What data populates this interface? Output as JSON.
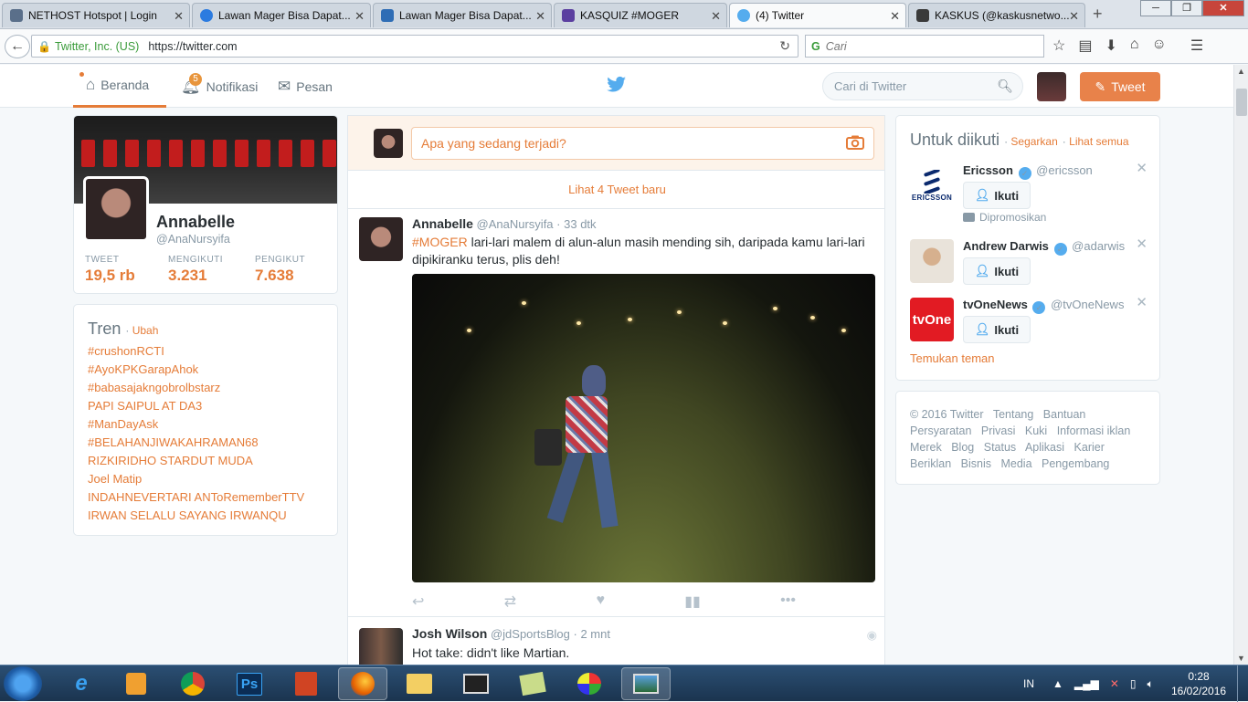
{
  "browser": {
    "tabs": [
      {
        "title": "NETHOST Hotspot | Login",
        "fav": "#5a6f8a"
      },
      {
        "title": "Lawan Mager Bisa Dapat...",
        "fav": "#2b7be0"
      },
      {
        "title": "Lawan Mager Bisa Dapat...",
        "fav": "#2f6db5"
      },
      {
        "title": "KASQUIZ #MOGER",
        "fav": "#5b3fa0"
      },
      {
        "title": "(4) Twitter",
        "fav": "#55acee"
      },
      {
        "title": "KASKUS (@kaskusnetwo...",
        "fav": "#3a3a3a"
      }
    ],
    "cert_label": "Twitter, Inc. (US)",
    "url": "https://twitter.com",
    "search_placeholder": "Cari"
  },
  "twitter_nav": {
    "home": "Beranda",
    "notifications": "Notifikasi",
    "notification_count": "5",
    "messages": "Pesan",
    "search_placeholder": "Cari di Twitter",
    "tweet_button": "Tweet"
  },
  "profile": {
    "name": "Annabelle",
    "handle": "@AnaNursyifa",
    "stats": [
      {
        "label": "TWEET",
        "value": "19,5 rb"
      },
      {
        "label": "MENGIKUTI",
        "value": "3.231"
      },
      {
        "label": "PENGIKUT",
        "value": "7.638"
      }
    ]
  },
  "trends": {
    "title": "Tren",
    "change": "Ubah",
    "items": [
      "#crushonRCTI",
      "#AyoKPKGarapAhok",
      "#babasajakngobrolbstarz",
      "PAPI SAIPUL AT DA3",
      "#ManDayAsk",
      "#BELAHANJIWAKAHRAMAN68",
      "RIZKIRIDHO STARDUT MUDA",
      "Joel Matip",
      "INDAHNEVERTARI ANToRememberTTV",
      "IRWAN SELALU SAYANG IRWANQU"
    ]
  },
  "composer": {
    "placeholder": "Apa yang sedang terjadi?"
  },
  "new_tweets_text": "Lihat 4 Tweet baru",
  "tweets": [
    {
      "name": "Annabelle",
      "handle": "@AnaNursyifa",
      "time": "33 dtk",
      "hashtag": "#MOGER",
      "text": " lari-lari malem di alun-alun masih mending sih, daripada kamu lari-lari dipikiranku terus, plis deh!"
    },
    {
      "name": "Josh Wilson",
      "handle": "@jdSportsBlog",
      "time": "2 mnt",
      "text": "Hot take: didn't like Martian."
    }
  ],
  "who_to_follow": {
    "title": "Untuk diikuti",
    "refresh": "Segarkan",
    "view_all": "Lihat semua",
    "follow_label": "Ikuti",
    "promoted_label": "Dipromosikan",
    "find_friends": "Temukan teman",
    "accounts": [
      {
        "name": "Ericsson",
        "handle": "@ericsson",
        "logo_text": "ERICSSON"
      },
      {
        "name": "Andrew Darwis",
        "handle": "@adarwis"
      },
      {
        "name": "tvOneNews",
        "handle": "@tvOneNews",
        "logo_text": "tvOne"
      }
    ]
  },
  "footer": {
    "links": [
      "© 2016 Twitter",
      "Tentang",
      "Bantuan",
      "Persyaratan",
      "Privasi",
      "Kuki",
      "Informasi iklan",
      "Merek",
      "Blog",
      "Status",
      "Aplikasi",
      "Karier",
      "Beriklan",
      "Bisnis",
      "Media",
      "Pengembang"
    ]
  },
  "taskbar": {
    "lang": "IN",
    "time": "0:28",
    "date": "16/02/2016",
    "ps_label": "Ps"
  },
  "colors": {
    "accent": "#e57c38",
    "twitter_blue": "#55acee"
  }
}
